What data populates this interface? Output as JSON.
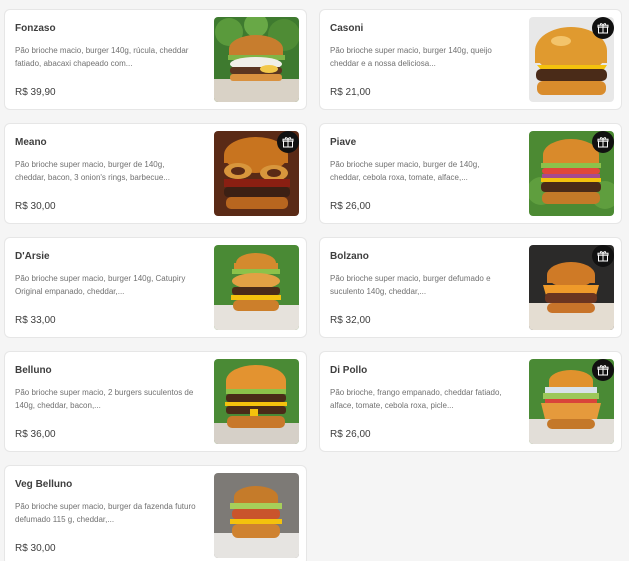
{
  "colors": {
    "card_bg": "#ffffff",
    "title": "#3e3e3e",
    "description": "#717171",
    "price": "#3e3e3e",
    "gift_badge": "#111111"
  },
  "items": [
    {
      "name": "Fonzaso",
      "description": "Pão brioche macio, burger 140g, rúcula, cheddar fatiado, abacaxi chapeado com...",
      "price": "R$ 39,90",
      "gift": false,
      "photo_icon": "burger-photo"
    },
    {
      "name": "Casoni",
      "description": "Pão brioche super macio, burger 140g, queijo cheddar e a nossa deliciosa...",
      "price": "R$ 21,00",
      "gift": true,
      "photo_icon": "burger-photo"
    },
    {
      "name": "Meano",
      "description": "Pão brioche super macio, burger de 140g, cheddar, bacon, 3 onion's rings, barbecue...",
      "price": "R$ 30,00",
      "gift": true,
      "photo_icon": "burger-photo"
    },
    {
      "name": "Piave",
      "description": "Pão brioche super macio, burger de 140g, cheddar, cebola roxa, tomate, alface,...",
      "price": "R$ 26,00",
      "gift": true,
      "photo_icon": "burger-photo"
    },
    {
      "name": "D'Arsie",
      "description": "Pão brioche super macio, burger 140g, Catupiry Original empanado, cheddar,...",
      "price": "R$ 33,00",
      "gift": false,
      "photo_icon": "burger-photo"
    },
    {
      "name": "Bolzano",
      "description": "Pão brioche super macio, burger defumado e suculento 140g, cheddar,...",
      "price": "R$ 32,00",
      "gift": true,
      "photo_icon": "burger-photo"
    },
    {
      "name": "Belluno",
      "description": "Pão brioche super macio, 2 burgers suculentos de 140g, cheddar, bacon,...",
      "price": "R$ 36,00",
      "gift": false,
      "photo_icon": "burger-photo"
    },
    {
      "name": "Di Pollo",
      "description": "Pão brioche, frango empanado, cheddar fatiado, alface, tomate, cebola roxa, picle...",
      "price": "R$ 26,00",
      "gift": true,
      "photo_icon": "chicken-burger-photo"
    },
    {
      "name": "Veg Belluno",
      "description": "Pão brioche super macio, burger da fazenda futuro defumado 115 g, cheddar,...",
      "price": "R$ 30,00",
      "gift": false,
      "photo_icon": "veggie-burger-photo"
    }
  ],
  "gift_icon": "gift-icon"
}
